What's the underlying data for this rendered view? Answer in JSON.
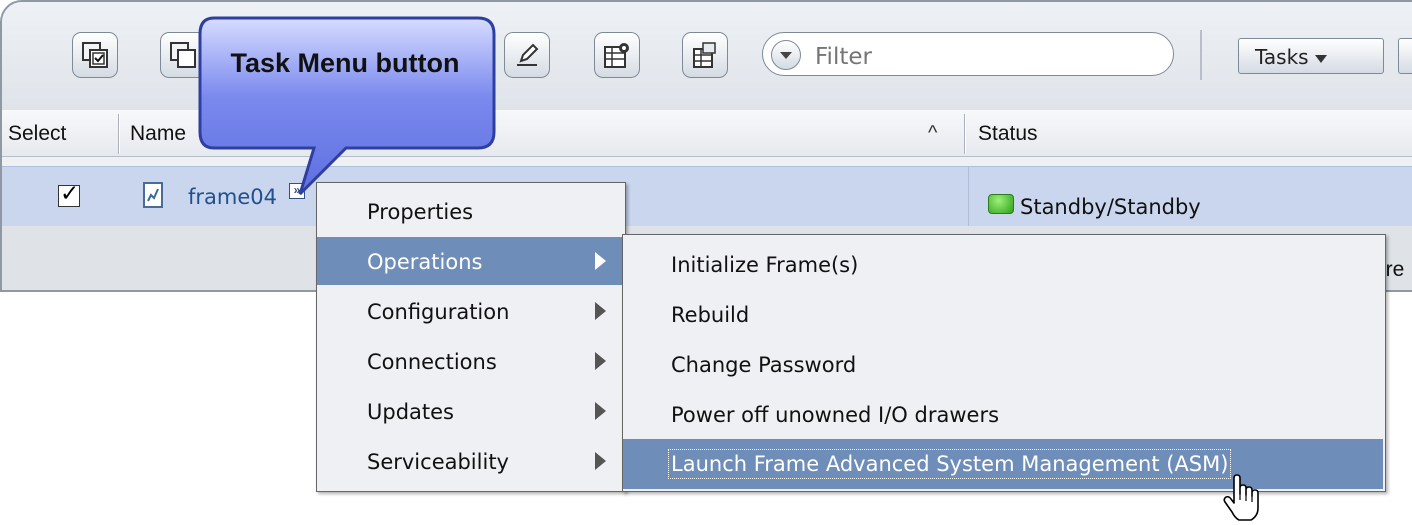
{
  "toolbar": {
    "buttons": [
      "select-all-icon",
      "deselect-all-icon",
      "edit-icon",
      "configure-columns-icon",
      "properties-icon"
    ],
    "filter": {
      "value": "Filter",
      "placeholder": "Filter"
    },
    "tasks_label": "Tasks"
  },
  "table": {
    "headers": {
      "select": "Select",
      "name": "Name",
      "status": "Status"
    },
    "sort_indicator": "^",
    "rows": [
      {
        "selected": true,
        "name": "frame04",
        "status": "Standby/Standby",
        "status_color": "#3cb521"
      }
    ],
    "footer_fragment": "ere"
  },
  "callout": {
    "text": "Task Menu button"
  },
  "context_menu": {
    "items": [
      {
        "label": "Properties",
        "has_submenu": false
      },
      {
        "label": "Operations",
        "has_submenu": true,
        "highlighted": true
      },
      {
        "label": "Configuration",
        "has_submenu": true
      },
      {
        "label": "Connections",
        "has_submenu": true
      },
      {
        "label": "Updates",
        "has_submenu": true
      },
      {
        "label": "Serviceability",
        "has_submenu": true
      }
    ]
  },
  "submenu": {
    "items": [
      {
        "label": "Initialize Frame(s)"
      },
      {
        "label": "Rebuild"
      },
      {
        "label": "Change Password"
      },
      {
        "label": "Power off unowned I/O drawers"
      },
      {
        "label": "Launch Frame Advanced System Management (ASM)",
        "highlighted": true
      }
    ]
  },
  "colors": {
    "accent": "#6f8db9",
    "row_selected": "#c9d6ee",
    "callout_fill": "#6d7fe6",
    "status_ok": "#3cb521"
  }
}
